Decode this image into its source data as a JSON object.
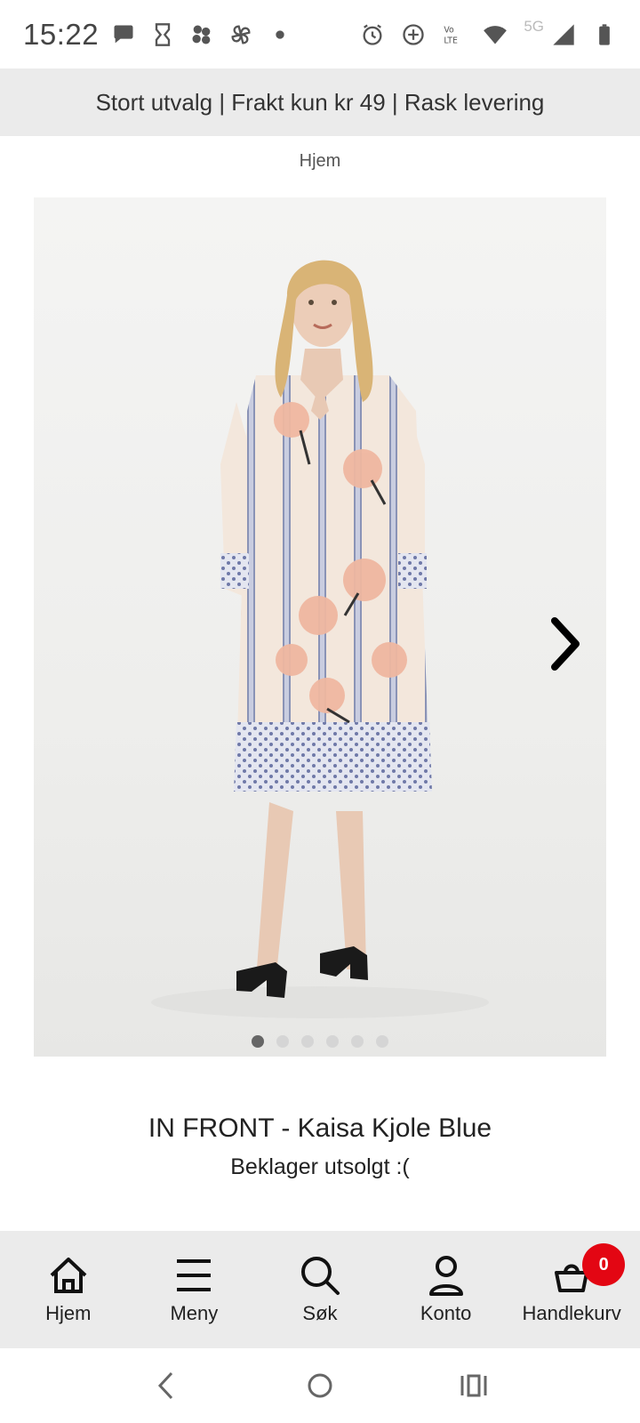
{
  "status_bar": {
    "time": "15:22",
    "left_icons": [
      "chat-bubble-icon",
      "hourglass-icon",
      "blocks-app-icon",
      "pinwheel-icon",
      "dot-icon"
    ],
    "right_icons": [
      "alarm-icon",
      "data-saver-icon",
      "volte-icon",
      "wifi-icon",
      "signal-icon",
      "battery-icon"
    ],
    "network_label": "5G"
  },
  "banner": {
    "text": "Stort utvalg | Frakt kun kr 49 | Rask levering"
  },
  "breadcrumb": {
    "home_label": "Hjem"
  },
  "product": {
    "title": "IN FRONT - Kaisa Kjole Blue",
    "availability": "Beklager utsolgt :(",
    "gallery": {
      "image_count": 6,
      "active_index": 0
    }
  },
  "bottom_nav": {
    "items": [
      {
        "label": "Hjem",
        "icon": "home-icon"
      },
      {
        "label": "Meny",
        "icon": "menu-icon"
      },
      {
        "label": "Søk",
        "icon": "search-icon"
      },
      {
        "label": "Konto",
        "icon": "account-icon"
      },
      {
        "label": "Handlekurv",
        "icon": "cart-icon"
      }
    ],
    "cart_count": "0"
  },
  "colors": {
    "banner_bg": "#ebebeb",
    "nav_bg": "#ebebeb",
    "badge_red": "#e30613"
  }
}
